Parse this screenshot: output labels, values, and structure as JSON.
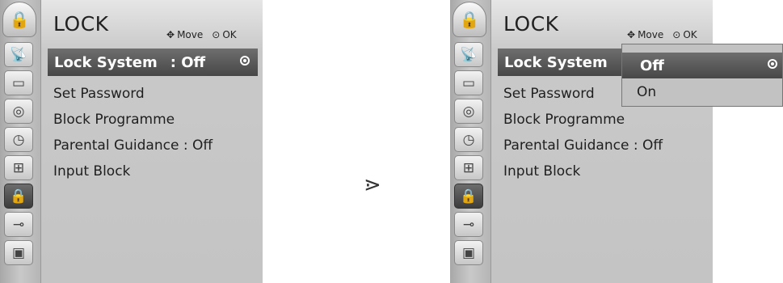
{
  "arrow_symbol": "⋗",
  "left_panel": {
    "title": "LOCK",
    "hint_move": "Move",
    "hint_ok": "OK",
    "hint_move_symbol": "✥",
    "hint_ok_symbol": "⊙",
    "selected_item": {
      "label": "Lock System",
      "value": ": Off"
    },
    "items": [
      {
        "label": "Set Password"
      },
      {
        "label": "Block Programme"
      },
      {
        "label": "Parental Guidance : Off"
      },
      {
        "label": "Input Block"
      }
    ]
  },
  "right_panel": {
    "title": "LOCK",
    "hint_move": "Move",
    "hint_ok": "OK",
    "hint_move_symbol": "✥",
    "hint_ok_symbol": "⊙",
    "selected_item": {
      "label": "Lock System"
    },
    "items": [
      {
        "label": "Set Password"
      },
      {
        "label": "Block Programme"
      },
      {
        "label": "Parental Guidance : Off"
      },
      {
        "label": "Input Block"
      }
    ],
    "dropdown": {
      "options": [
        "Off",
        "On"
      ],
      "selected": "Off"
    }
  },
  "sidebar_icons": [
    {
      "name": "lock-menu-icon",
      "glyph": "🔒"
    },
    {
      "name": "satellite-dish-icon",
      "glyph": "📡"
    },
    {
      "name": "monitor-icon",
      "glyph": "▭"
    },
    {
      "name": "speaker-icon",
      "glyph": "◎"
    },
    {
      "name": "clock-icon",
      "glyph": "◷"
    },
    {
      "name": "option-icon",
      "glyph": "⊞"
    },
    {
      "name": "lock-icon",
      "glyph": "🔒"
    },
    {
      "name": "input-plug-icon",
      "glyph": "⊸"
    },
    {
      "name": "photo-icon",
      "glyph": "▣"
    }
  ],
  "colors": {
    "sidebar": "#b5b5b5",
    "panel_bg": "#c4c4c4",
    "selected_bar": "#474747",
    "selected_text": "#ffffff"
  }
}
